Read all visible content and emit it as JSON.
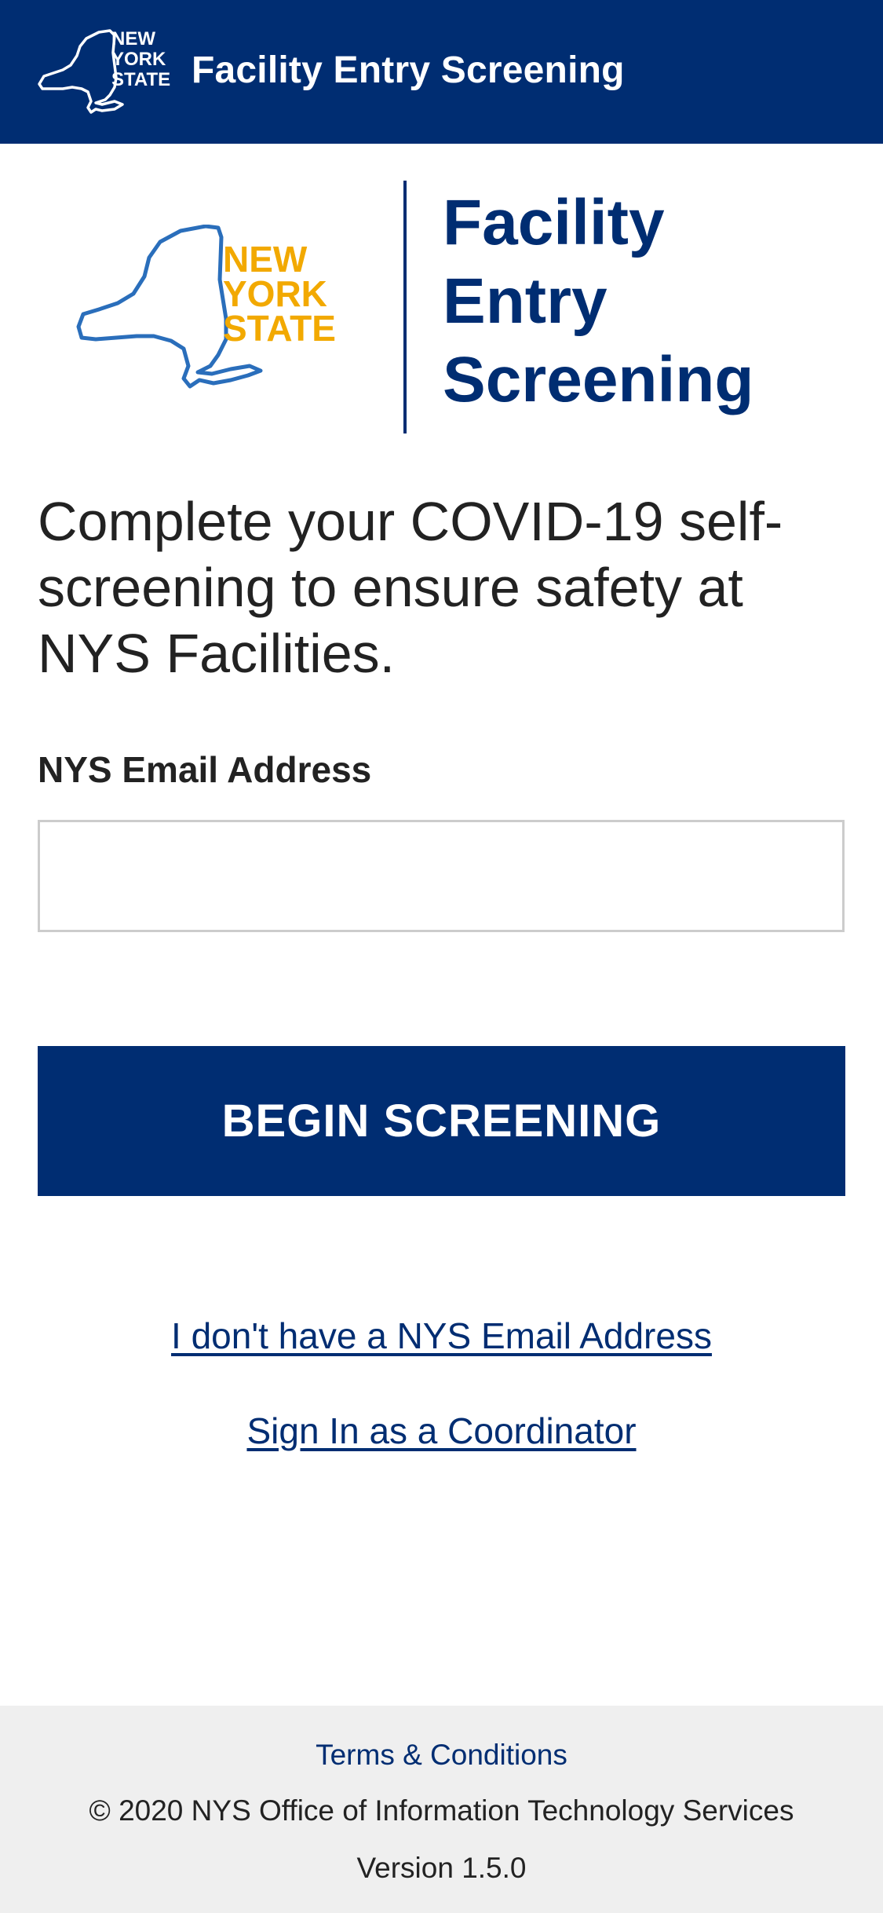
{
  "header": {
    "logo_text": [
      "NEW",
      "YORK",
      "STATE"
    ],
    "title": "Facility Entry Screening"
  },
  "hero": {
    "logo_text": [
      "NEW",
      "YORK",
      "STATE"
    ],
    "title_lines": [
      "Facility",
      "Entry",
      "Screening"
    ]
  },
  "intro": {
    "text": "Complete your COVID-19 self-screening to ensure safety at NYS Facilities."
  },
  "form": {
    "email_label": "NYS Email Address",
    "email_value": "",
    "begin_button": "BEGIN SCREENING"
  },
  "links": {
    "no_email": "I don't have a NYS Email Address",
    "coordinator": "Sign In as a Coordinator"
  },
  "footer": {
    "terms": "Terms & Conditions",
    "copyright": "© 2020 NYS Office of Information Technology Services",
    "version": "Version 1.5.0"
  },
  "colors": {
    "brand_navy": "#002d72",
    "logo_gold": "#f2a900",
    "logo_blue": "#2a6ebb",
    "footer_bg": "#efefef",
    "input_border": "#cccccc"
  },
  "icons": {
    "header_logo": "nys-state-outline-logo-icon",
    "hero_logo": "nys-state-color-logo-icon"
  }
}
